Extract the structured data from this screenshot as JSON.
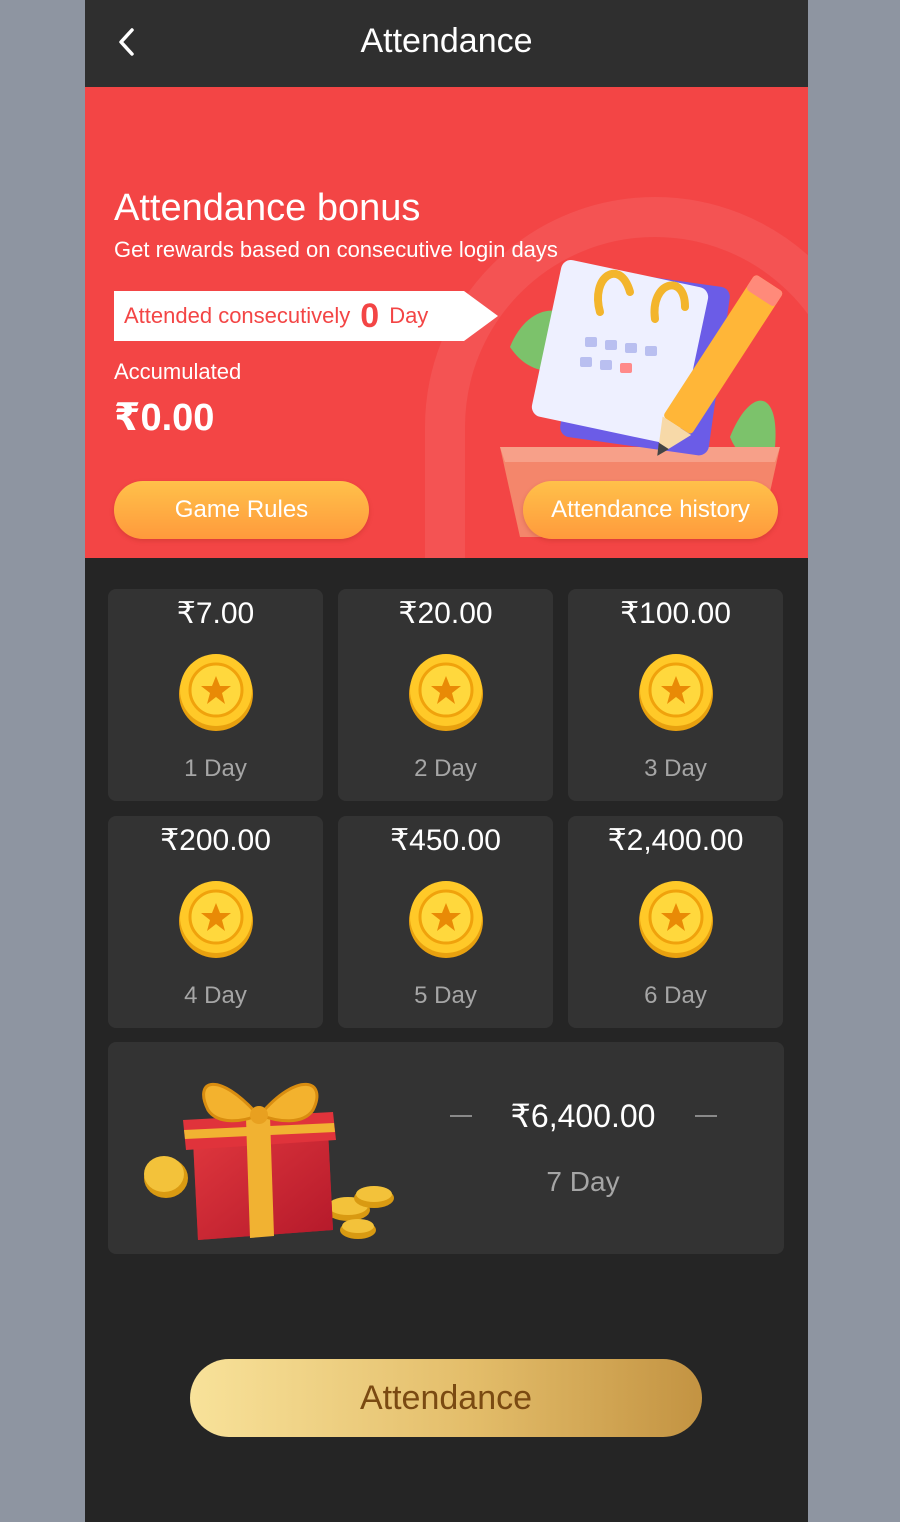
{
  "header": {
    "title": "Attendance",
    "back_icon": "chevron-left-icon"
  },
  "banner": {
    "title": "Attendance bonus",
    "subtitle": "Get rewards based on consecutive login days",
    "consecutive_label": "Attended consecutively",
    "consecutive_days": "0",
    "consecutive_unit": "Day",
    "accumulated_label": "Accumulated",
    "accumulated_value": "₹0.00",
    "rules_button": "Game Rules",
    "history_button": "Attendance history",
    "illustration_icon": "calendar-pencil-icon"
  },
  "rewards": [
    {
      "amount": "₹7.00",
      "day": "1 Day"
    },
    {
      "amount": "₹20.00",
      "day": "2 Day"
    },
    {
      "amount": "₹100.00",
      "day": "3 Day"
    },
    {
      "amount": "₹200.00",
      "day": "4 Day"
    },
    {
      "amount": "₹450.00",
      "day": "5 Day"
    },
    {
      "amount": "₹2,400.00",
      "day": "6 Day"
    }
  ],
  "final_reward": {
    "amount": "₹6,400.00",
    "day": "7 Day",
    "icon": "gift-box-icon"
  },
  "attend_button": "Attendance",
  "colors": {
    "banner_red": "#f34545",
    "card_bg": "#333333",
    "page_bg": "#252525",
    "coin_gold": "#ffc928",
    "button_orange": "#ffa93f",
    "button_gold": "#e3bd6a"
  }
}
